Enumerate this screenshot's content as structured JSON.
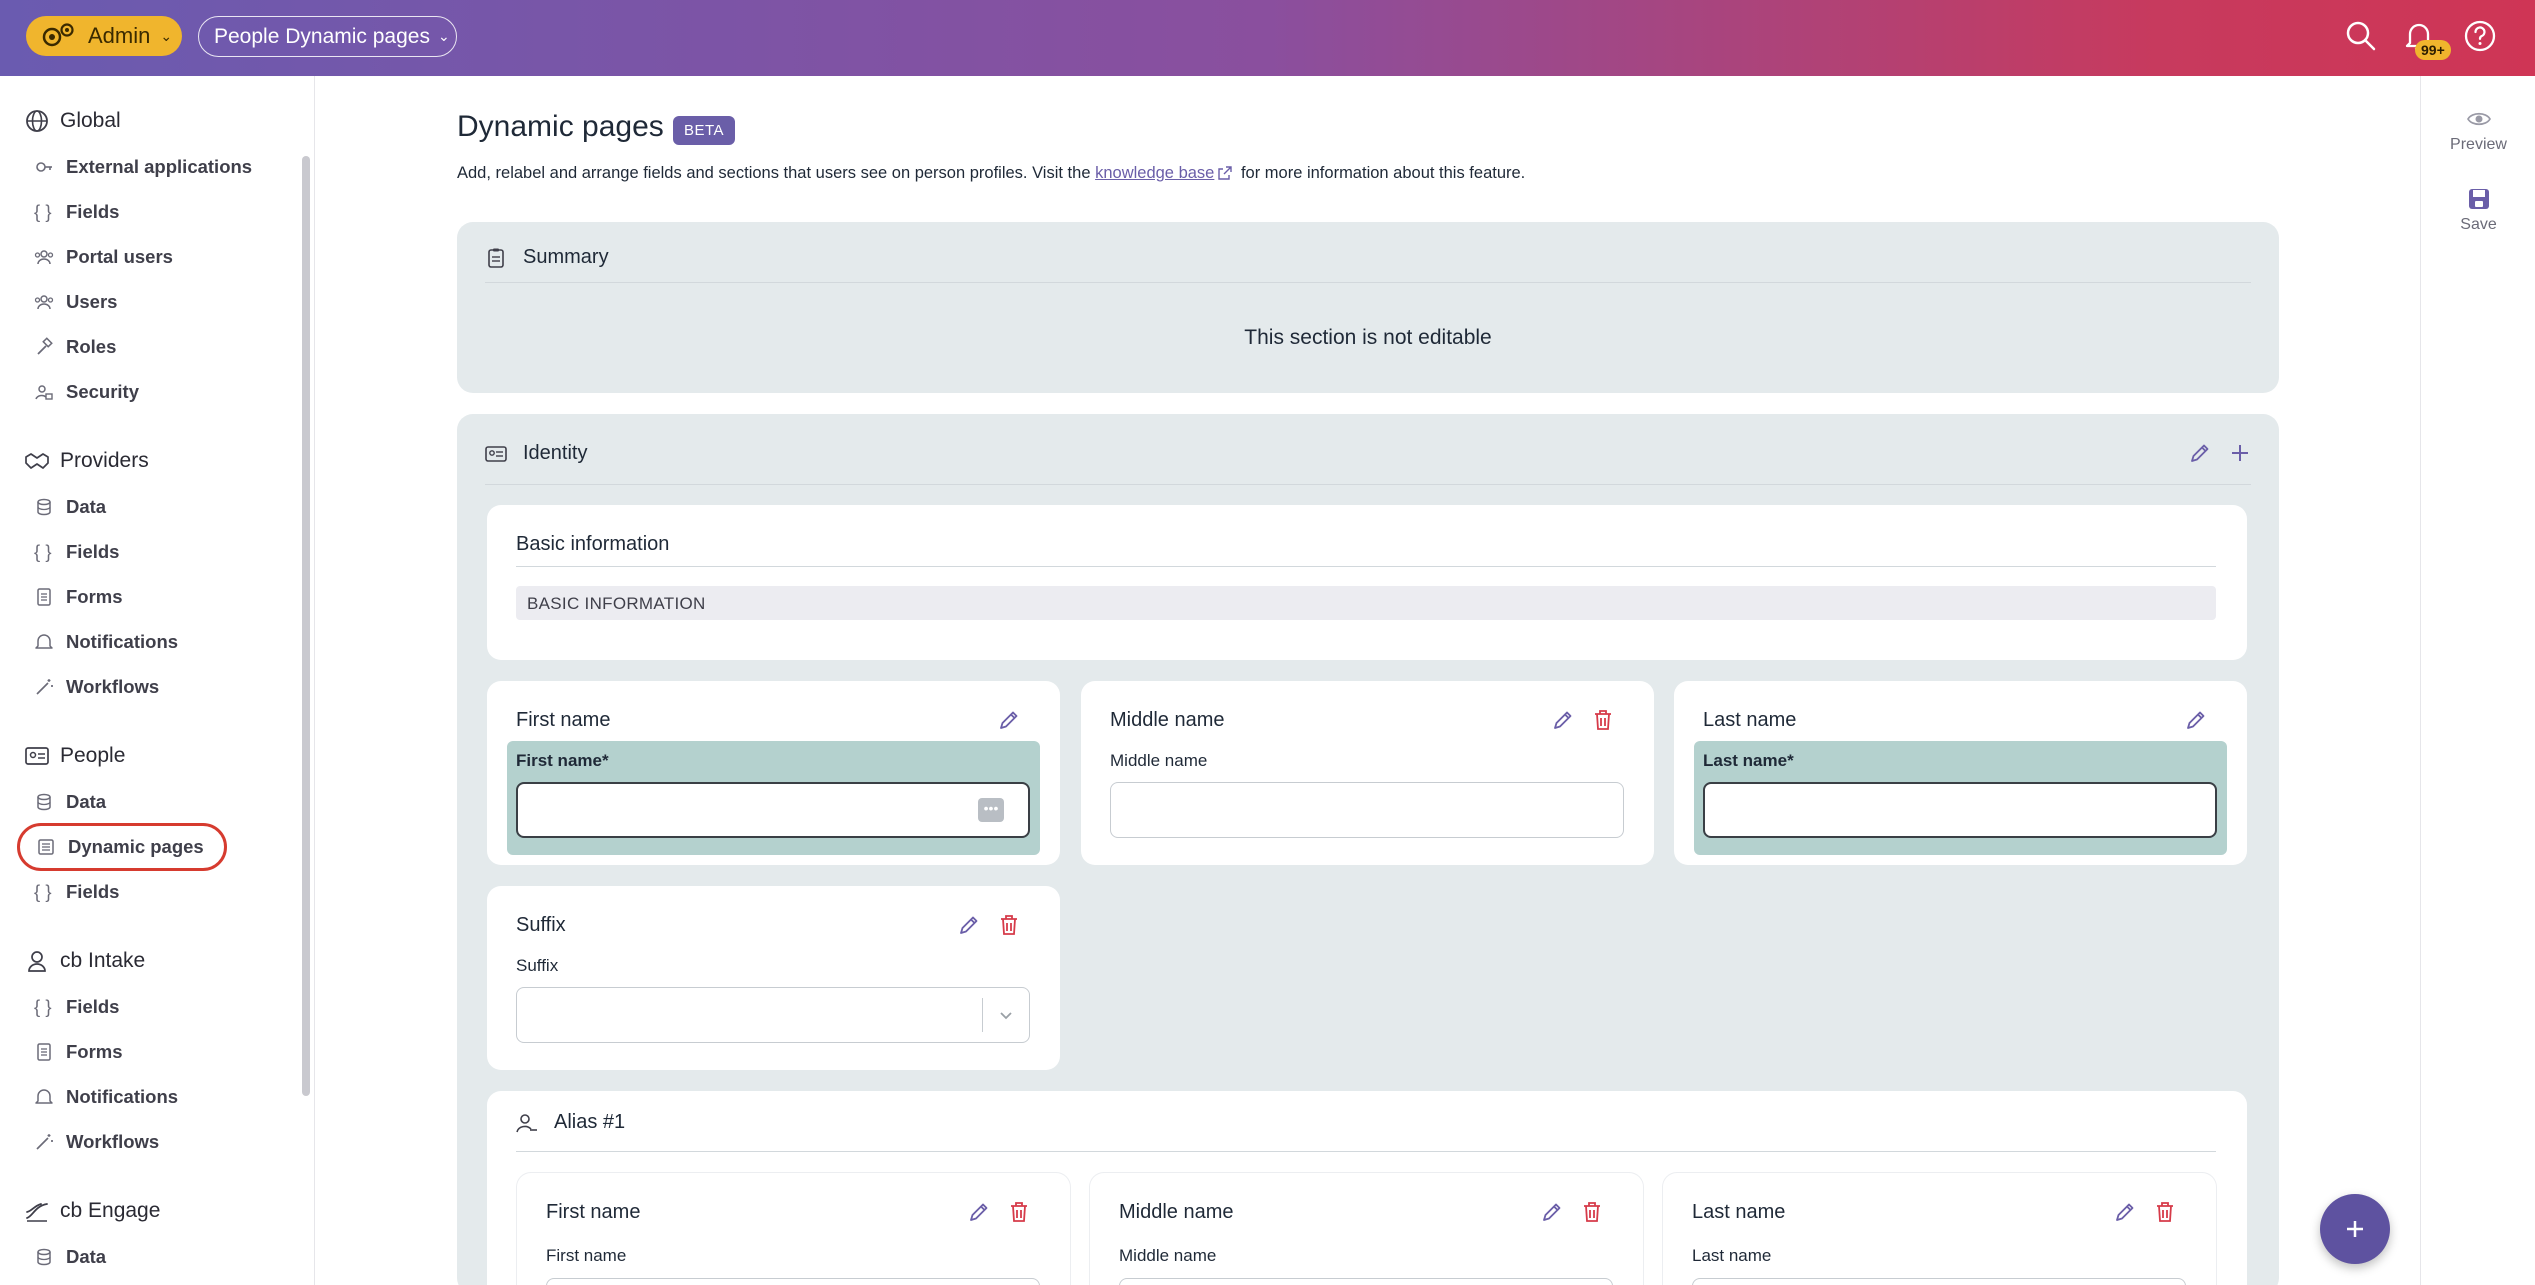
{
  "topbar": {
    "admin_label": "Admin",
    "page_select_label": "People Dynamic pages",
    "notification_count": "99+"
  },
  "sidebar": {
    "groups": [
      {
        "title": "Global",
        "icon": "globe-icon",
        "items": [
          {
            "label": "External applications",
            "icon": "key-icon"
          },
          {
            "label": "Fields",
            "icon": "braces-icon"
          },
          {
            "label": "Portal users",
            "icon": "users-group-icon"
          },
          {
            "label": "Users",
            "icon": "users-group-icon"
          },
          {
            "label": "Roles",
            "icon": "hammer-icon"
          },
          {
            "label": "Security",
            "icon": "user-lock-icon"
          }
        ]
      },
      {
        "title": "Providers",
        "icon": "handshake-icon",
        "items": [
          {
            "label": "Data",
            "icon": "database-icon"
          },
          {
            "label": "Fields",
            "icon": "braces-icon"
          },
          {
            "label": "Forms",
            "icon": "form-icon"
          },
          {
            "label": "Notifications",
            "icon": "bell-icon"
          },
          {
            "label": "Workflows",
            "icon": "wand-icon"
          }
        ]
      },
      {
        "title": "People",
        "icon": "id-card-icon",
        "items": [
          {
            "label": "Data",
            "icon": "database-icon"
          },
          {
            "label": "Dynamic pages",
            "icon": "page-layout-icon",
            "active": true
          },
          {
            "label": "Fields",
            "icon": "braces-icon"
          }
        ]
      },
      {
        "title": "cb Intake",
        "icon": "person-intake-icon",
        "items": [
          {
            "label": "Fields",
            "icon": "braces-icon"
          },
          {
            "label": "Forms",
            "icon": "form-icon"
          },
          {
            "label": "Notifications",
            "icon": "bell-icon"
          },
          {
            "label": "Workflows",
            "icon": "wand-icon"
          }
        ]
      },
      {
        "title": "cb Engage",
        "icon": "engage-icon",
        "items": [
          {
            "label": "Data",
            "icon": "database-icon"
          }
        ]
      }
    ]
  },
  "main": {
    "title": "Dynamic pages",
    "badge": "BETA",
    "desc_before": "Add, relabel and arrange fields and sections that users see on person profiles. Visit the",
    "desc_link": "knowledge base",
    "desc_after": "for more information about this feature.",
    "summary": {
      "title": "Summary",
      "note": "This section is not editable"
    },
    "identity": {
      "title": "Identity",
      "basic": {
        "title": "Basic information",
        "bar": "BASIC INFORMATION"
      },
      "fields": [
        {
          "title": "First name",
          "label": "First name",
          "required": "*"
        },
        {
          "title": "Middle name",
          "label": "Middle name"
        },
        {
          "title": "Last name",
          "label": "Last name",
          "required": "*"
        },
        {
          "title": "Suffix",
          "label": "Suffix"
        }
      ],
      "alias": {
        "title": "Alias #1",
        "fields": [
          {
            "title": "First name",
            "label": "First name"
          },
          {
            "title": "Middle name",
            "label": "Middle name"
          },
          {
            "title": "Last name",
            "label": "Last name"
          }
        ]
      }
    }
  },
  "rail": {
    "preview": "Preview",
    "save": "Save"
  },
  "colors": {
    "accent": "#6a5ea8",
    "brand_yellow": "#f0b52d",
    "danger": "#d63b4a",
    "highlight": "#b4d1ce"
  }
}
